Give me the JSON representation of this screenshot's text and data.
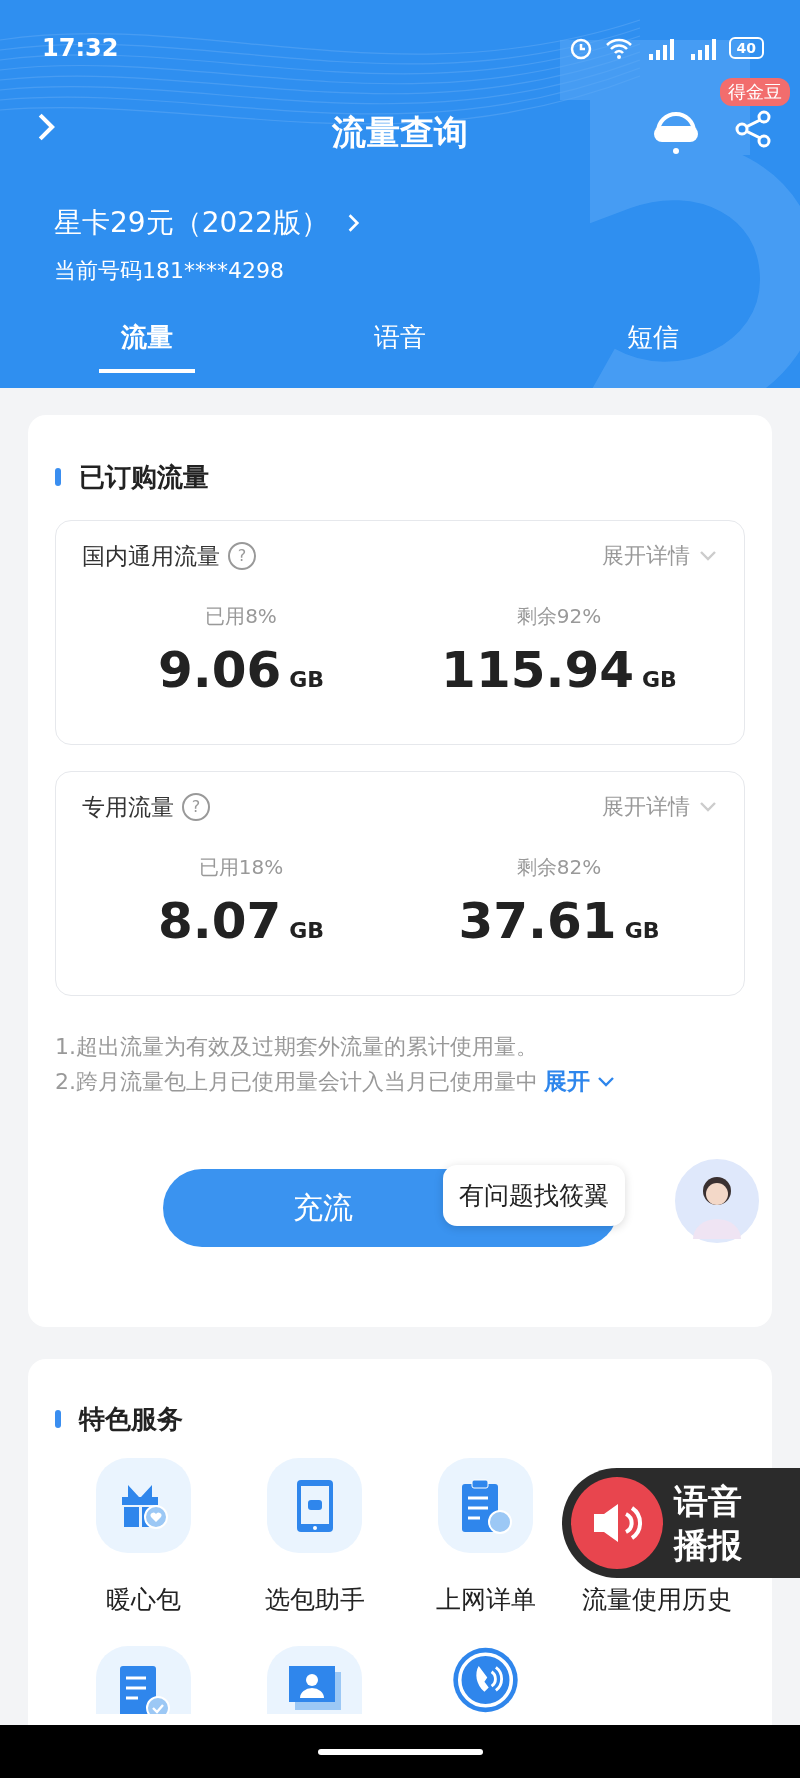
{
  "status_bar": {
    "time": "17:32",
    "battery": "40"
  },
  "nav": {
    "title": "流量查询",
    "badge": "得金豆"
  },
  "plan": {
    "name": "星卡29元（2022版）",
    "number": "当前号码181****4298"
  },
  "tabs": [
    {
      "label": "流量",
      "selected": true
    },
    {
      "label": "语音",
      "selected": false
    },
    {
      "label": "短信",
      "selected": false
    }
  ],
  "subscribed": {
    "title": "已订购流量",
    "groups": [
      {
        "name": "国内通用流量",
        "help": "?",
        "toggle": "展开详情",
        "used_label": "已用8%",
        "used_value": "9.06",
        "used_unit": "GB",
        "remaining_label": "剩余92%",
        "remaining_value": "115.94",
        "remaining_unit": "GB"
      },
      {
        "name": "专用流量",
        "help": "?",
        "toggle": "展开详情",
        "used_label": "已用18%",
        "used_value": "8.07",
        "used_unit": "GB",
        "remaining_label": "剩余82%",
        "remaining_value": "37.61",
        "remaining_unit": "GB"
      }
    ],
    "notes": [
      "1.超出流量为有效及过期套外流量的累计使用量。",
      "2.跨月流量包上月已使用量会计入当月已使用量中"
    ],
    "expand": "展开"
  },
  "recharge_button": "充流",
  "tooltip": "有问题找筱翼",
  "services": {
    "title": "特色服务",
    "items": [
      {
        "label": "暖心包",
        "kind": "gift"
      },
      {
        "label": "选包助手",
        "kind": "phone"
      },
      {
        "label": "上网详单",
        "kind": "clipboard"
      },
      {
        "label": "流量使用历史",
        "kind": "hidden"
      }
    ],
    "more_icons": [
      {
        "kind": "doccheck"
      },
      {
        "kind": "contact"
      },
      {
        "kind": "call"
      }
    ]
  },
  "voice": {
    "lines": [
      "语音",
      "播报"
    ]
  }
}
